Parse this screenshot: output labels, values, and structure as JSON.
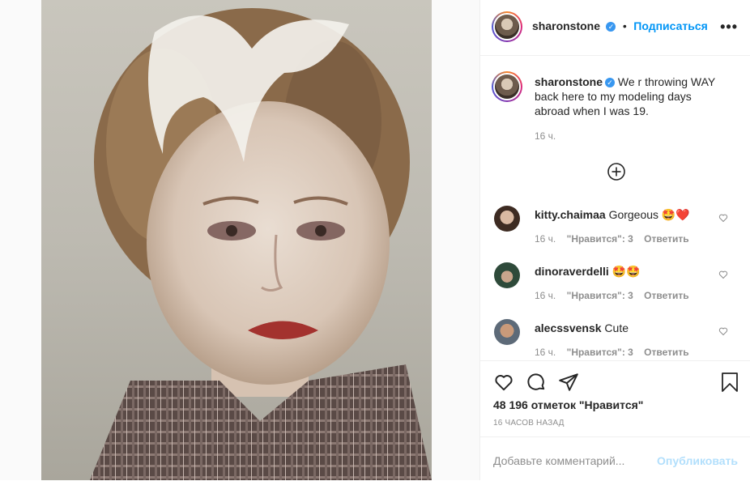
{
  "post": {
    "username": "sharonstone",
    "follow_label": "Подписаться",
    "dot": "•",
    "more_label": "•••",
    "caption": "We r throwing WAY back here to my modeling days abroad when I was 19.",
    "caption_time": "16 ч.",
    "load_more_icon": "plus-circle-icon"
  },
  "comments": [
    {
      "user": "kitty.chaimaa",
      "text": "Gorgeous 🤩❤️",
      "time": "16 ч.",
      "likes": "\"Нравится\": 3",
      "reply": "Ответить"
    },
    {
      "user": "dinoraverdelli",
      "text": "🤩🤩",
      "time": "16 ч.",
      "likes": "\"Нравится\": 3",
      "reply": "Ответить"
    },
    {
      "user": "alecssvensk",
      "text": "Cute",
      "time": "16 ч.",
      "likes": "\"Нравится\": 3",
      "reply": "Ответить"
    }
  ],
  "actions": {
    "likes_count": "48 196 отметок \"Нравится\"",
    "time_ago": "16 ЧАСОВ НАЗАД"
  },
  "composer": {
    "placeholder": "Добавьте комментарий...",
    "post_label": "Опубликовать"
  },
  "colors": {
    "accent": "#0095f6",
    "verified": "#3897f0",
    "text": "#262626",
    "muted": "#8e8e8e",
    "post_disabled": "#b2dffc"
  }
}
